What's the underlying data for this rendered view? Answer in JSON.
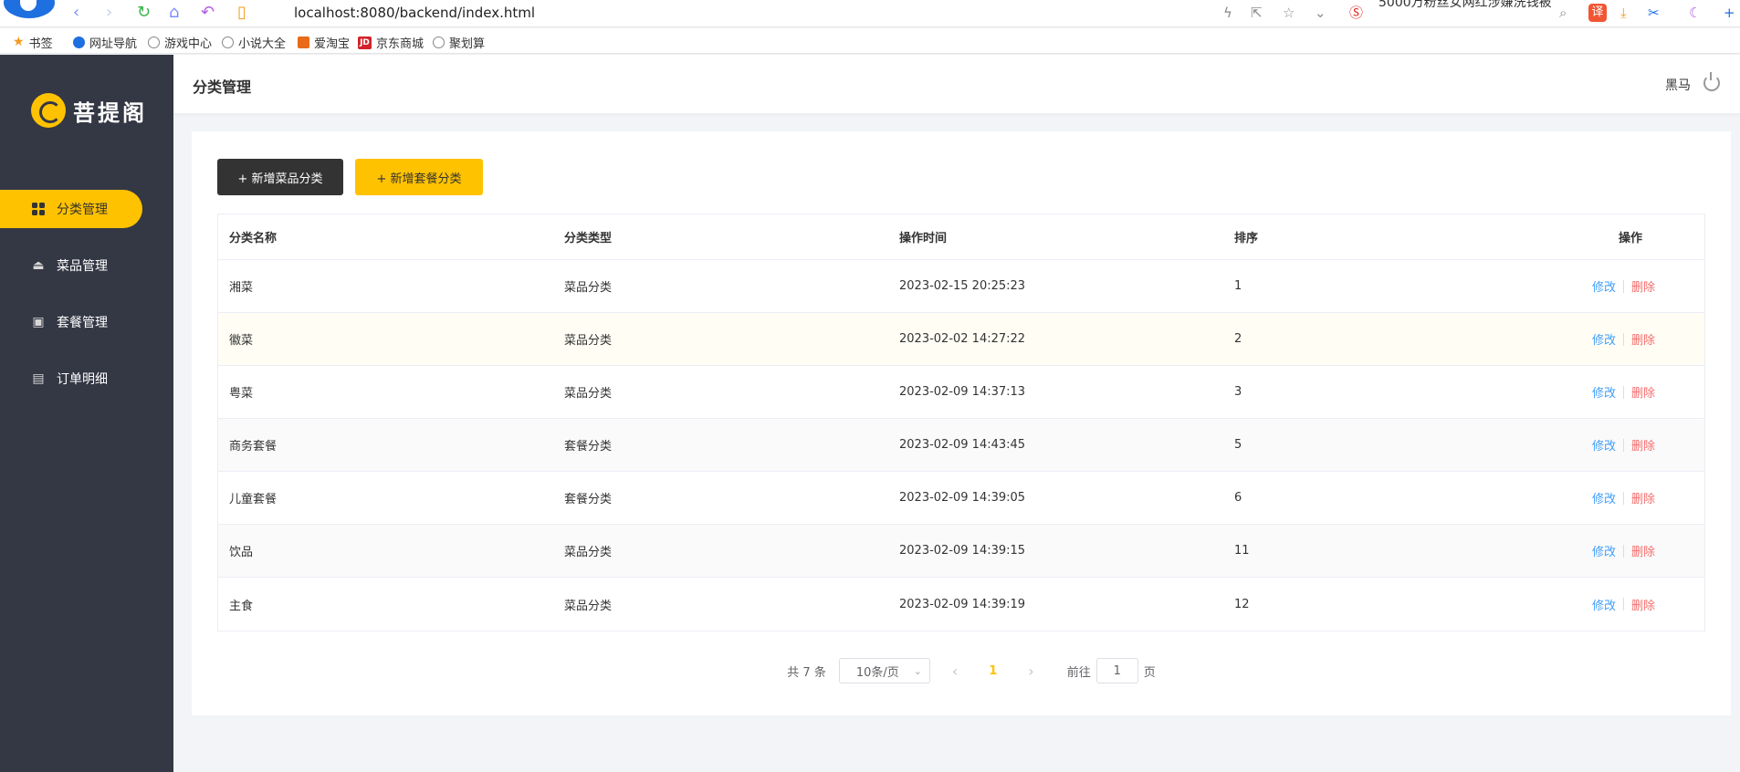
{
  "browser": {
    "url": "localhost:8080/backend/index.html",
    "news_text": "5000万粉丝女网红涉嫌洗钱被"
  },
  "bookmarks": [
    {
      "label": "书签"
    },
    {
      "label": "网址导航"
    },
    {
      "label": "游戏中心"
    },
    {
      "label": "小说大全"
    },
    {
      "label": "爱淘宝"
    },
    {
      "label": "京东商城"
    },
    {
      "label": "聚划算"
    }
  ],
  "app": {
    "logo_text": "菩提阁",
    "page_title": "分类管理",
    "user_name": "黑马"
  },
  "sidebar": {
    "items": [
      {
        "label": "分类管理",
        "icon": "grid-icon"
      },
      {
        "label": "菜品管理",
        "icon": "dish-cover-icon"
      },
      {
        "label": "套餐管理",
        "icon": "gift-icon"
      },
      {
        "label": "订单明细",
        "icon": "clipboard-icon"
      }
    ]
  },
  "toolbar": {
    "add_dish_category": "+ 新增菜品分类",
    "add_combo_category": "+ 新增套餐分类"
  },
  "table": {
    "headers": [
      "分类名称",
      "分类类型",
      "操作时间",
      "排序",
      "操作"
    ],
    "edit_label": "修改",
    "delete_label": "删除",
    "rows": [
      {
        "name": "湘菜",
        "type": "菜品分类",
        "time": "2023-02-15 20:25:23",
        "sort": "1"
      },
      {
        "name": "徽菜",
        "type": "菜品分类",
        "time": "2023-02-02 14:27:22",
        "sort": "2"
      },
      {
        "name": "粤菜",
        "type": "菜品分类",
        "time": "2023-02-09 14:37:13",
        "sort": "3"
      },
      {
        "name": "商务套餐",
        "type": "套餐分类",
        "time": "2023-02-09 14:43:45",
        "sort": "5"
      },
      {
        "name": "儿童套餐",
        "type": "套餐分类",
        "time": "2023-02-09 14:39:05",
        "sort": "6"
      },
      {
        "name": "饮品",
        "type": "菜品分类",
        "time": "2023-02-09 14:39:15",
        "sort": "11"
      },
      {
        "name": "主食",
        "type": "菜品分类",
        "time": "2023-02-09 14:39:19",
        "sort": "12"
      }
    ]
  },
  "pagination": {
    "total": "共 7 条",
    "page_size": "10条/页",
    "current_page": "1",
    "goto_prefix": "前往",
    "goto_value": "1",
    "goto_suffix": "页"
  }
}
